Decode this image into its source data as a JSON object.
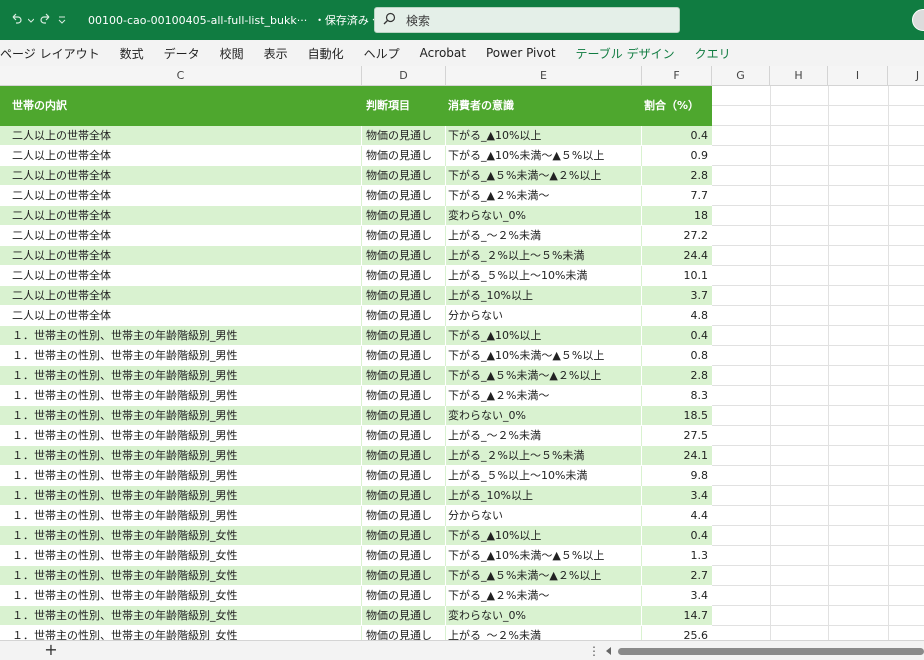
{
  "titlebar": {
    "filename": "00100-cao-00100405-all-full-list_bukk···",
    "saved_status": "保存済み",
    "search_placeholder": "検索"
  },
  "ribbon": {
    "tabs": [
      "ページ レイアウト",
      "数式",
      "データ",
      "校閲",
      "表示",
      "自動化",
      "ヘルプ",
      "Acrobat",
      "Power Pivot"
    ],
    "context_tabs": [
      "テーブル デザイン",
      "クエリ"
    ]
  },
  "columns": [
    "C",
    "D",
    "E",
    "F",
    "G",
    "H",
    "I",
    "J"
  ],
  "table": {
    "headers": [
      "世帯の内訳",
      "判断項目",
      "消費者の意識",
      "割合（%）"
    ],
    "rows": [
      [
        "二人以上の世帯全体",
        "物価の見通し",
        "下がる_▲10%以上",
        "0.4"
      ],
      [
        "二人以上の世帯全体",
        "物価の見通し",
        "下がる_▲10%未満～▲５%以上",
        "0.9"
      ],
      [
        "二人以上の世帯全体",
        "物価の見通し",
        "下がる_▲５%未満～▲２%以上",
        "2.8"
      ],
      [
        "二人以上の世帯全体",
        "物価の見通し",
        "下がる_▲２%未満～",
        "7.7"
      ],
      [
        "二人以上の世帯全体",
        "物価の見通し",
        "変わらない_0%",
        "18"
      ],
      [
        "二人以上の世帯全体",
        "物価の見通し",
        "上がる_～２%未満",
        "27.2"
      ],
      [
        "二人以上の世帯全体",
        "物価の見通し",
        "上がる_２%以上～５%未満",
        "24.4"
      ],
      [
        "二人以上の世帯全体",
        "物価の見通し",
        "上がる_５%以上～10%未満",
        "10.1"
      ],
      [
        "二人以上の世帯全体",
        "物価の見通し",
        "上がる_10%以上",
        "3.7"
      ],
      [
        "二人以上の世帯全体",
        "物価の見通し",
        "分からない",
        "4.8"
      ],
      [
        "１．世帯主の性別、世帯主の年齢階級別_男性",
        "物価の見通し",
        "下がる_▲10%以上",
        "0.4"
      ],
      [
        "１．世帯主の性別、世帯主の年齢階級別_男性",
        "物価の見通し",
        "下がる_▲10%未満～▲５%以上",
        "0.8"
      ],
      [
        "１．世帯主の性別、世帯主の年齢階級別_男性",
        "物価の見通し",
        "下がる_▲５%未満～▲２%以上",
        "2.8"
      ],
      [
        "１．世帯主の性別、世帯主の年齢階級別_男性",
        "物価の見通し",
        "下がる_▲２%未満～",
        "8.3"
      ],
      [
        "１．世帯主の性別、世帯主の年齢階級別_男性",
        "物価の見通し",
        "変わらない_0%",
        "18.5"
      ],
      [
        "１．世帯主の性別、世帯主の年齢階級別_男性",
        "物価の見通し",
        "上がる_～２%未満",
        "27.5"
      ],
      [
        "１．世帯主の性別、世帯主の年齢階級別_男性",
        "物価の見通し",
        "上がる_２%以上～５%未満",
        "24.1"
      ],
      [
        "１．世帯主の性別、世帯主の年齢階級別_男性",
        "物価の見通し",
        "上がる_５%以上～10%未満",
        "9.8"
      ],
      [
        "１．世帯主の性別、世帯主の年齢階級別_男性",
        "物価の見通し",
        "上がる_10%以上",
        "3.4"
      ],
      [
        "１．世帯主の性別、世帯主の年齢階級別_男性",
        "物価の見通し",
        "分からない",
        "4.4"
      ],
      [
        "１．世帯主の性別、世帯主の年齢階級別_女性",
        "物価の見通し",
        "下がる_▲10%以上",
        "0.4"
      ],
      [
        "１．世帯主の性別、世帯主の年齢階級別_女性",
        "物価の見通し",
        "下がる_▲10%未満～▲５%以上",
        "1.3"
      ],
      [
        "１．世帯主の性別、世帯主の年齢階級別_女性",
        "物価の見通し",
        "下がる_▲５%未満～▲２%以上",
        "2.7"
      ],
      [
        "１．世帯主の性別、世帯主の年齢階級別_女性",
        "物価の見通し",
        "下がる_▲２%未満～",
        "3.4"
      ],
      [
        "１．世帯主の性別、世帯主の年齢階級別_女性",
        "物価の見通し",
        "変わらない_0%",
        "14.7"
      ],
      [
        "１．世帯主の性別、世帯主の年齢階級別_女性",
        "物価の見通し",
        "上がる_～２%未満",
        "25.6"
      ]
    ]
  },
  "colors": {
    "app_green": "#107c41",
    "header_green": "#4ea72e",
    "band_green": "#d9f2d0",
    "context_tab": "#107c41"
  },
  "icons": [
    "undo-icon",
    "redo-icon",
    "qat-dropdown-icon",
    "search-icon",
    "chevron-down-icon",
    "add-sheet-icon",
    "scroll-left-icon"
  ]
}
